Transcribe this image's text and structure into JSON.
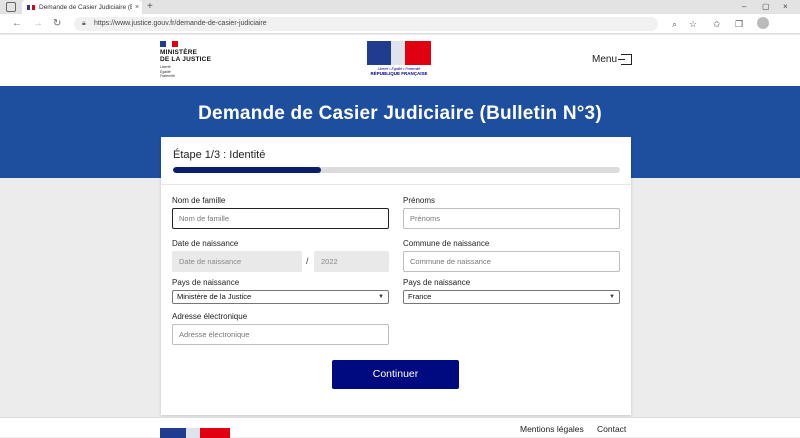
{
  "browser": {
    "tab_title": "Demande de Casier Judiciaire (B",
    "tab_close": "×",
    "new_tab": "+",
    "url": "https://www.justice.gouv.fr/demande-de-casier-judiciaire",
    "minimize": "–",
    "maximize": "▢",
    "close": "×"
  },
  "header": {
    "ministry_name": "MINISTÈRE\nDE LA JUSTICE",
    "ministry_motto": "Liberté\nÉgalité\nFraternité",
    "rf_motto": "Liberté • Égalité • Fraternité",
    "rf_name": "RÉPUBLIQUE FRANÇAISE",
    "menu_label": "Menu"
  },
  "banner": {
    "title": "Demande de Casier Judiciaire (Bulletin N°3)"
  },
  "form": {
    "step_label": "Étape 1/3 : Identité",
    "progress": 0.33,
    "last_name_label": "Nom de famille",
    "last_name_placeholder": "Nom de famille",
    "first_names_label": "Prénoms",
    "first_names_placeholder": "Prénoms",
    "birth_date_label": "Date de naissance",
    "birth_date_placeholder": "Date de naissance",
    "birth_date_separator": "/",
    "birth_year_placeholder": "2022",
    "birth_commune_label": "Commune de naissance",
    "birth_commune_placeholder": "Commune de naissance",
    "birth_country_label_left": "Pays de naissance",
    "birth_country_value_left": "Ministère de la Justice",
    "birth_country_label_right": "Pays de naissance",
    "birth_country_value_right": "France",
    "email_label": "Adresse électronique",
    "email_placeholder": "Adresse électronique",
    "submit_label": "Continuer"
  },
  "footer": {
    "legal_link": "Mentions légales",
    "contact_link": "Contact"
  },
  "colors": {
    "banner_blue": "#1d4f9e",
    "button_navy": "#000a80",
    "progress_fill": "#0a1f6b",
    "marianne_red": "#e1000f"
  }
}
